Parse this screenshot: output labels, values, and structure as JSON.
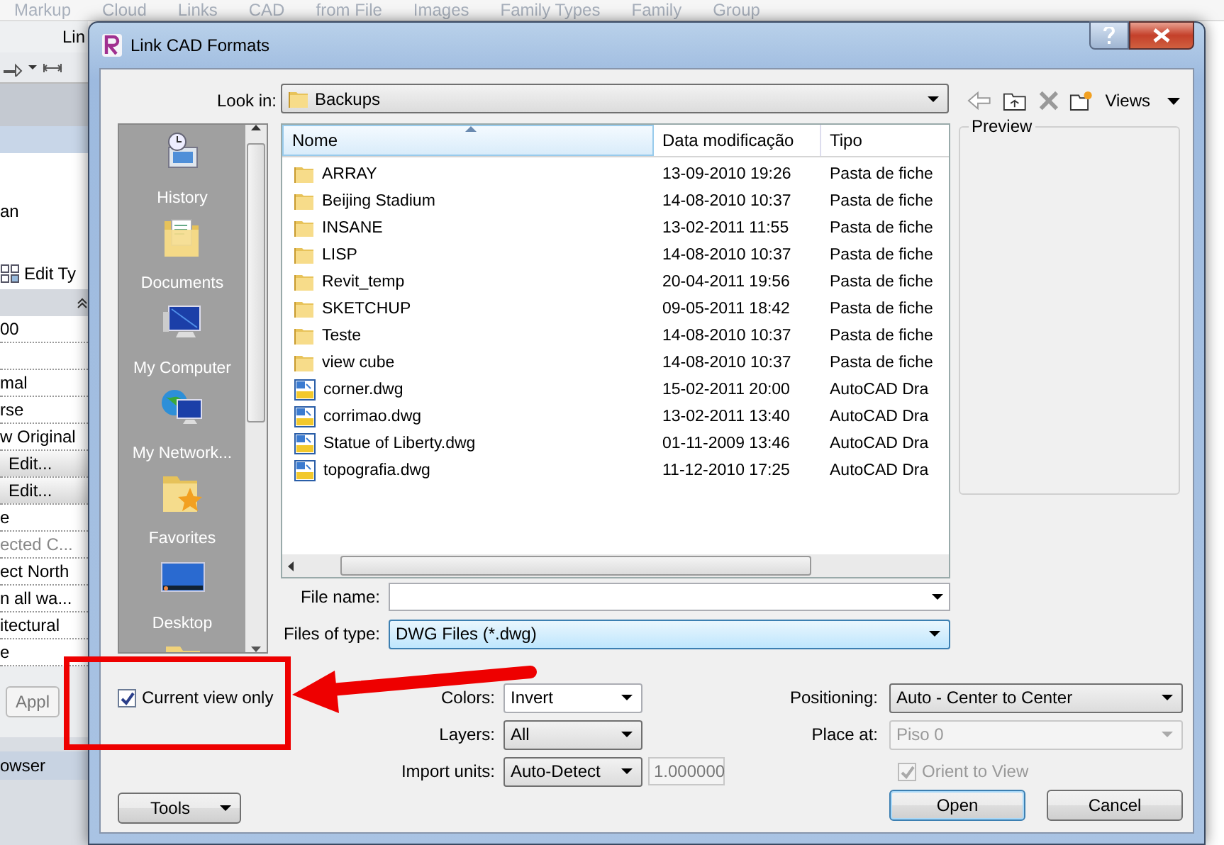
{
  "background_app": {
    "ribbon_labels": [
      "Markup",
      "Cloud",
      "Links",
      "CAD",
      "from File",
      "Images",
      "Family Types",
      "Family",
      "Group"
    ],
    "tab_label": "Lin",
    "type_text": "an",
    "edit_type_button": "Edit Ty",
    "properties_rows": [
      {
        "kind": "value",
        "text": "00"
      },
      {
        "kind": "blank"
      },
      {
        "kind": "value",
        "text": "mal"
      },
      {
        "kind": "value",
        "text": "rse"
      },
      {
        "kind": "value",
        "text": "w Original"
      },
      {
        "kind": "button",
        "text": "Edit..."
      },
      {
        "kind": "button",
        "text": "Edit..."
      },
      {
        "kind": "value",
        "text": "e"
      },
      {
        "kind": "disabled",
        "text": "ected C..."
      },
      {
        "kind": "value",
        "text": "ect North"
      },
      {
        "kind": "value",
        "text": "n all wa..."
      },
      {
        "kind": "value",
        "text": "itectural"
      },
      {
        "kind": "value",
        "text": "e"
      }
    ],
    "apply_button": "Appl",
    "bottom_tab": "owser"
  },
  "dialog": {
    "title": "Link CAD Formats",
    "look_in": {
      "label": "Look in:",
      "value": "Backups"
    },
    "views_button": "Views",
    "places": [
      {
        "kind": "history",
        "label": "History"
      },
      {
        "kind": "documents",
        "label": "Documents"
      },
      {
        "kind": "computer",
        "label": "My Computer"
      },
      {
        "kind": "network",
        "label": "My Network..."
      },
      {
        "kind": "favorites",
        "label": "Favorites"
      },
      {
        "kind": "desktop",
        "label": "Desktop"
      },
      {
        "kind": "folder"
      }
    ],
    "file_list": {
      "columns": [
        {
          "label": "Nome",
          "sorted": true
        },
        {
          "label": "Data modificação",
          "sorted": false
        },
        {
          "label": "Tipo",
          "sorted": false
        }
      ],
      "rows": [
        {
          "kind": "folder",
          "name": "ARRAY",
          "date": "13-09-2010 19:26",
          "type": "Pasta de fiche"
        },
        {
          "kind": "folder",
          "name": "Beijing Stadium",
          "date": "14-08-2010 10:37",
          "type": "Pasta de fiche"
        },
        {
          "kind": "folder",
          "name": "INSANE",
          "date": "13-02-2011 11:55",
          "type": "Pasta de fiche"
        },
        {
          "kind": "folder",
          "name": "LISP",
          "date": "14-08-2010 10:37",
          "type": "Pasta de fiche"
        },
        {
          "kind": "folder",
          "name": "Revit_temp",
          "date": "20-04-2011 19:56",
          "type": "Pasta de fiche"
        },
        {
          "kind": "folder",
          "name": "SKETCHUP",
          "date": "09-05-2011 18:42",
          "type": "Pasta de fiche"
        },
        {
          "kind": "folder",
          "name": "Teste",
          "date": "14-08-2010 10:37",
          "type": "Pasta de fiche"
        },
        {
          "kind": "folder",
          "name": "view cube",
          "date": "14-08-2010 10:37",
          "type": "Pasta de fiche"
        },
        {
          "kind": "dwg",
          "name": "corner.dwg",
          "date": "15-02-2011 20:00",
          "type": "AutoCAD Dra"
        },
        {
          "kind": "dwg",
          "name": "corrimao.dwg",
          "date": "13-02-2011 13:40",
          "type": "AutoCAD Dra"
        },
        {
          "kind": "dwg",
          "name": "Statue of Liberty.dwg",
          "date": "01-11-2009 13:46",
          "type": "AutoCAD Dra"
        },
        {
          "kind": "dwg",
          "name": "topografia.dwg",
          "date": "11-12-2010 17:25",
          "type": "AutoCAD Dra"
        }
      ]
    },
    "preview": {
      "label": "Preview"
    },
    "file_name": {
      "label": "File name:"
    },
    "files_of_type": {
      "label": "Files of type:",
      "value": "DWG Files  (*.dwg)"
    },
    "current_view_only": {
      "label": "Current view only",
      "checked": true
    },
    "colors": {
      "label": "Colors:",
      "value": "Invert"
    },
    "layers": {
      "label": "Layers:",
      "value": "All"
    },
    "import_units": {
      "label": "Import units:",
      "value": "Auto-Detect",
      "factor": "1.000000"
    },
    "positioning": {
      "label": "Positioning:",
      "value": "Auto - Center to Center"
    },
    "place_at": {
      "label": "Place at:",
      "value": "Piso 0",
      "disabled": true
    },
    "orient_to_view": {
      "label": "Orient to View",
      "checked": true,
      "disabled": true
    },
    "tools_button": "Tools",
    "buttons": [
      {
        "kind": "open",
        "label": "Open"
      },
      {
        "kind": "cancel",
        "label": "Cancel"
      }
    ]
  }
}
